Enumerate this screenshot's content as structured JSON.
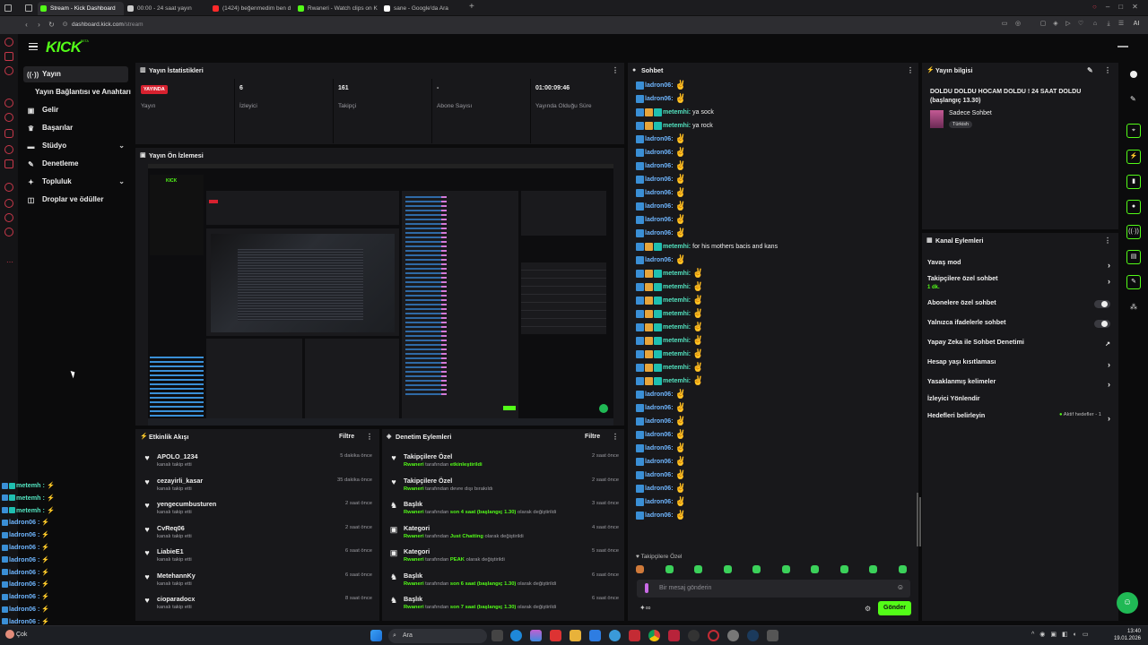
{
  "browser": {
    "tabs": [
      {
        "label": "Stream - Kick Dashboard",
        "color": "#53fc18",
        "active": true
      },
      {
        "label": "00:00 - 24 saat yayın",
        "color": "#cccccc",
        "active": false
      },
      {
        "label": "(1424) beğenmedim ben d",
        "color": "#ff2a2a",
        "active": false
      },
      {
        "label": "Rwaneri - Watch clips on K",
        "color": "#53fc18",
        "active": false
      },
      {
        "label": "sane - Google'da Ara",
        "color": "#ffffff",
        "active": false
      }
    ],
    "url_domain": "dashboard.kick.com",
    "url_path": "/stream"
  },
  "kick": {
    "logo": "KICK",
    "logo_sup": "BETA"
  },
  "sidebar": {
    "items": [
      {
        "label": "Yayın",
        "icon": "broadcast-icon"
      },
      {
        "label": "Yayın Bağlantısı ve Anahtarı",
        "icon": ""
      },
      {
        "label": "Gelir",
        "icon": "wallet-icon"
      },
      {
        "label": "Başarılar",
        "icon": "trophy-icon"
      },
      {
        "label": "Stüdyo",
        "icon": "studio-icon"
      },
      {
        "label": "Denetleme",
        "icon": "wrench-icon"
      },
      {
        "label": "Topluluk",
        "icon": "community-icon"
      },
      {
        "label": "Droplar ve ödüller",
        "icon": "gift-icon"
      }
    ]
  },
  "stats": {
    "title": "Yayın İstatistikleri",
    "live_badge": "YAYINDA",
    "live_label": "Yayın",
    "viewers": "6",
    "viewers_label": "İzleyici",
    "followers": "161",
    "followers_label": "Takipçi",
    "subs": "-",
    "subs_label": "Abone Sayısı",
    "uptime": "01:00:09:46",
    "uptime_label": "Yayında Olduğu Süre"
  },
  "preview": {
    "title": "Yayın Ön İzlemesi"
  },
  "activity": {
    "title": "Etkinlik Akışı",
    "filter": "Filtre",
    "rows": [
      {
        "name": "APOLO_1234",
        "sub": "kanalı takip etti",
        "time": "5 dakika önce"
      },
      {
        "name": "cezayirli_kasar",
        "sub": "kanalı takip etti",
        "time": "35 dakika önce"
      },
      {
        "name": "yengecumbusturen",
        "sub": "kanalı takip etti",
        "time": "2 saat önce"
      },
      {
        "name": "CvReq06",
        "sub": "kanalı takip etti",
        "time": "2 saat önce"
      },
      {
        "name": "LiabieE1",
        "sub": "kanalı takip etti",
        "time": "6 saat önce"
      },
      {
        "name": "MetehannKy",
        "sub": "kanalı takip etti",
        "time": "6 saat önce"
      },
      {
        "name": "cioparadocx",
        "sub": "kanalı takip etti",
        "time": "8 saat önce"
      }
    ]
  },
  "moderation": {
    "title": "Denetim Eylemleri",
    "filter": "Filtre",
    "rows": [
      {
        "icon": "heart-icon",
        "name": "Takipçilere Özel",
        "who": "Rwaneri",
        "mid": " tarafından ",
        "hl": "etkinleştirildi",
        "tail": "",
        "time": "2 saat önce"
      },
      {
        "icon": "heart-icon",
        "name": "Takipçilere Özel",
        "who": "Rwaneri",
        "mid": " tarafından devre dışı bırakıldı",
        "hl": "",
        "tail": "",
        "time": "2 saat önce"
      },
      {
        "icon": "title-icon",
        "name": "Başlık",
        "who": "Rwaneri",
        "mid": " tarafından ",
        "hl": "son 4 saat (başlangıç 1.30)",
        "tail": " olarak değiştirildi",
        "time": "3 saat önce"
      },
      {
        "icon": "category-icon",
        "name": "Kategori",
        "who": "Rwaneri",
        "mid": " tarafından ",
        "hl": "Just Chatting",
        "tail": " olarak değiştirildi",
        "time": "4 saat önce"
      },
      {
        "icon": "category-icon",
        "name": "Kategori",
        "who": "Rwaneri",
        "mid": " tarafından ",
        "hl": "PEAK",
        "tail": " olarak değiştirildi",
        "time": "5 saat önce"
      },
      {
        "icon": "title-icon",
        "name": "Başlık",
        "who": "Rwaneri",
        "mid": " tarafından ",
        "hl": "son 6 saat (başlangıç 1.30)",
        "tail": " olarak değiştirildi",
        "time": "6 saat önce"
      },
      {
        "icon": "title-icon",
        "name": "Başlık",
        "who": "Rwaneri",
        "mid": " tarafından ",
        "hl": "son 7 saat (başlangıç 1.30)",
        "tail": " olarak değiştirildi",
        "time": "6 saat önce"
      }
    ]
  },
  "chat": {
    "title": "Sohbet",
    "lines": [
      {
        "user": "ladron06",
        "color": "#6fb6ff",
        "msg": "",
        "emote": true
      },
      {
        "user": "ladron06",
        "color": "#6fb6ff",
        "msg": "",
        "emote": true
      },
      {
        "user": "metemhi",
        "color": "#53e3c0",
        "msg": "ya sock",
        "emote": false
      },
      {
        "user": "metemhi",
        "color": "#53e3c0",
        "msg": "ya rock",
        "emote": false
      },
      {
        "user": "ladron06",
        "color": "#6fb6ff",
        "msg": "",
        "emote": true
      },
      {
        "user": "ladron06",
        "color": "#6fb6ff",
        "msg": "",
        "emote": true
      },
      {
        "user": "ladron06",
        "color": "#6fb6ff",
        "msg": "",
        "emote": true
      },
      {
        "user": "ladron06",
        "color": "#6fb6ff",
        "msg": "",
        "emote": true
      },
      {
        "user": "ladron06",
        "color": "#6fb6ff",
        "msg": "",
        "emote": true
      },
      {
        "user": "ladron06",
        "color": "#6fb6ff",
        "msg": "",
        "emote": true
      },
      {
        "user": "ladron06",
        "color": "#6fb6ff",
        "msg": "",
        "emote": true
      },
      {
        "user": "ladron06",
        "color": "#6fb6ff",
        "msg": "",
        "emote": true
      },
      {
        "user": "metemhi",
        "color": "#53e3c0",
        "msg": "for his mothers bacis and kans",
        "emote": false
      },
      {
        "user": "ladron06",
        "color": "#6fb6ff",
        "msg": "",
        "emote": true
      },
      {
        "user": "metemhi",
        "color": "#53e3c0",
        "msg": "",
        "emote": true
      },
      {
        "user": "metemhi",
        "color": "#53e3c0",
        "msg": "",
        "emote": true
      },
      {
        "user": "metemhi",
        "color": "#53e3c0",
        "msg": "",
        "emote": true
      },
      {
        "user": "metemhi",
        "color": "#53e3c0",
        "msg": "",
        "emote": true
      },
      {
        "user": "metemhi",
        "color": "#53e3c0",
        "msg": "",
        "emote": true
      },
      {
        "user": "metemhi",
        "color": "#53e3c0",
        "msg": "",
        "emote": true
      },
      {
        "user": "metemhi",
        "color": "#53e3c0",
        "msg": "",
        "emote": true
      },
      {
        "user": "metemhi",
        "color": "#53e3c0",
        "msg": "",
        "emote": true
      },
      {
        "user": "metemhi",
        "color": "#53e3c0",
        "msg": "",
        "emote": true
      },
      {
        "user": "ladron06",
        "color": "#6fb6ff",
        "msg": "",
        "emote": true
      },
      {
        "user": "ladron06",
        "color": "#6fb6ff",
        "msg": "",
        "emote": true
      },
      {
        "user": "ladron06",
        "color": "#6fb6ff",
        "msg": "",
        "emote": true
      },
      {
        "user": "ladron06",
        "color": "#6fb6ff",
        "msg": "",
        "emote": true
      },
      {
        "user": "ladron06",
        "color": "#6fb6ff",
        "msg": "",
        "emote": true
      },
      {
        "user": "ladron06",
        "color": "#6fb6ff",
        "msg": "",
        "emote": true
      },
      {
        "user": "ladron06",
        "color": "#6fb6ff",
        "msg": "",
        "emote": true
      },
      {
        "user": "ladron06",
        "color": "#6fb6ff",
        "msg": "",
        "emote": true
      },
      {
        "user": "ladron06",
        "color": "#6fb6ff",
        "msg": "",
        "emote": true
      },
      {
        "user": "ladron06",
        "color": "#6fb6ff",
        "msg": "",
        "emote": true
      }
    ],
    "mode_label": "Takipçilere Özel",
    "input_placeholder": "Bir mesaj gönderin",
    "send_label": "Gönder"
  },
  "stream_info": {
    "title": "Yayın bilgisi",
    "stream_title": "DOLDU DOLDU HOCAM DOLDU ! 24 SAAT DOLDU (başlangıç 13.30)",
    "category": "Sadece Sohbet",
    "tag": "Türkish"
  },
  "channel_actions": {
    "title": "Kanal Eylemleri",
    "slow_mode": "Yavaş mod",
    "followers_only": "Takipçilere özel sohbet",
    "followers_only_sub": "1 dk.",
    "subs_only": "Abonelere özel sohbet",
    "emotes_only": "Yalnızca ifadelerle sohbet",
    "ai_mod": "Yapay Zeka ile Sohbet Denetimi",
    "age_restrict": "Hesap yaşı kısıtlaması",
    "banned_words": "Yasaklanmış kelimeler",
    "raid": "İzleyici Yönlendir",
    "goals": "Hedefleri belirleyin",
    "goals_status": "Aktif hedefler - 1"
  },
  "overlay_chat": [
    {
      "user": "metemh",
      "color": "#53e3c0"
    },
    {
      "user": "metemh",
      "color": "#53e3c0"
    },
    {
      "user": "metemh",
      "color": "#53e3c0"
    },
    {
      "user": "ladron06",
      "color": "#6fb6ff"
    },
    {
      "user": "ladron06",
      "color": "#6fb6ff"
    },
    {
      "user": "ladron06",
      "color": "#6fb6ff"
    },
    {
      "user": "ladron06",
      "color": "#6fb6ff"
    },
    {
      "user": "ladron06",
      "color": "#6fb6ff"
    },
    {
      "user": "ladron06",
      "color": "#6fb6ff"
    },
    {
      "user": "ladron06",
      "color": "#6fb6ff"
    },
    {
      "user": "ladron06",
      "color": "#6fb6ff"
    },
    {
      "user": "ladron06",
      "color": "#6fb6ff"
    },
    {
      "user": "ladron06",
      "color": "#6fb6ff"
    }
  ],
  "taskbar": {
    "search_label": "Ara",
    "time": "13:40",
    "date": "19.01.2026",
    "weather": "Çok"
  }
}
